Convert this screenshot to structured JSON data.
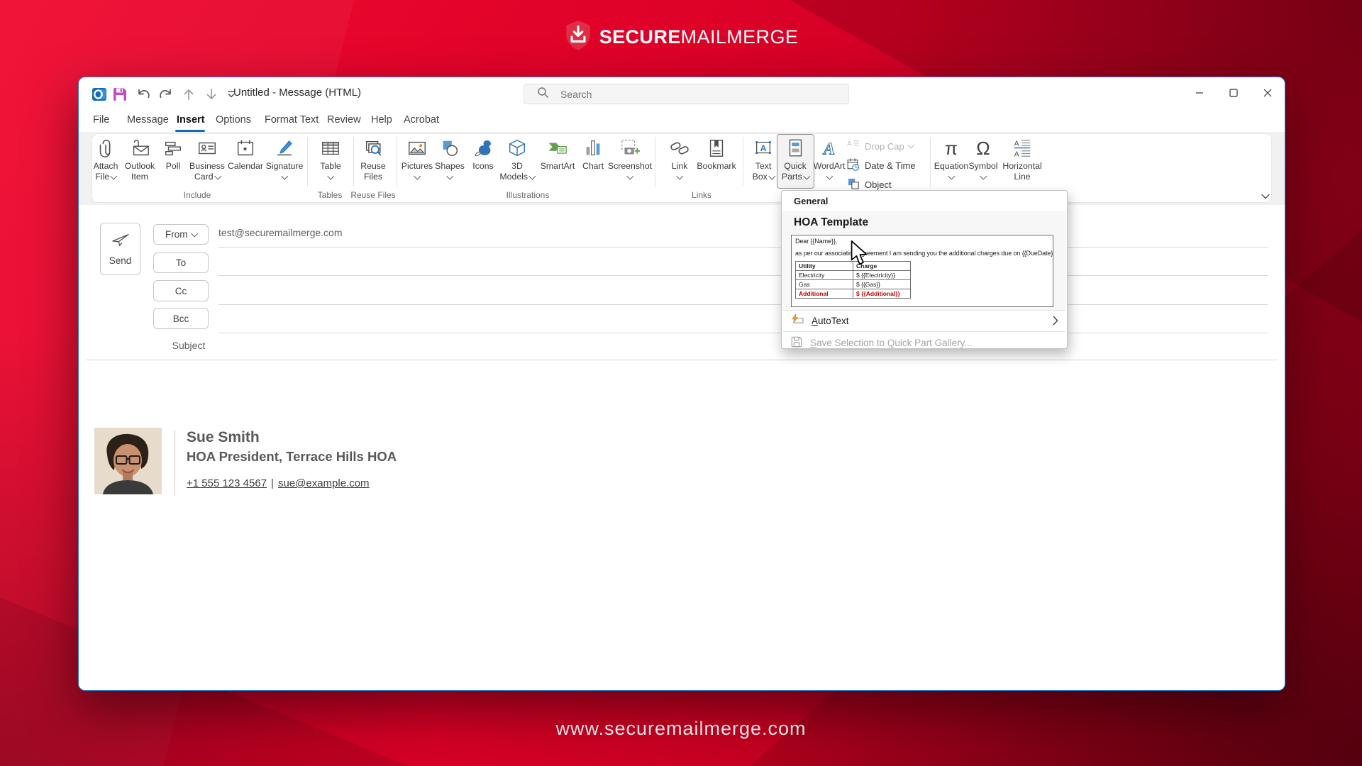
{
  "brand": {
    "bold": "SECURE",
    "rest": "MAILMERGE"
  },
  "footer_url": "www.securemailmerge.com",
  "window": {
    "title": "Untitled - Message (HTML)",
    "search_placeholder": "Search"
  },
  "tabs": [
    "File",
    "Message",
    "Insert",
    "Options",
    "Format Text",
    "Review",
    "Help",
    "Acrobat"
  ],
  "ribbon": {
    "attach_file_1": "Attach",
    "attach_file_2": "File",
    "outlook_item_1": "Outlook",
    "outlook_item_2": "Item",
    "poll": "Poll",
    "business_card_1": "Business",
    "business_card_2": "Card",
    "calendar": "Calendar",
    "signature": "Signature",
    "table": "Table",
    "reuse_files_1": "Reuse",
    "reuse_files_2": "Files",
    "pictures": "Pictures",
    "shapes": "Shapes",
    "icons": "Icons",
    "models_1": "3D",
    "models_2": "Models",
    "smartart": "SmartArt",
    "chart": "Chart",
    "screenshot": "Screenshot",
    "link": "Link",
    "bookmark": "Bookmark",
    "text_box_1": "Text",
    "text_box_2": "Box",
    "quick_parts_1": "Quick",
    "quick_parts_2": "Parts",
    "wordart": "WordArt",
    "drop_cap": "Drop Cap",
    "date_time": "Date & Time",
    "object": "Object",
    "equation": "Equation",
    "symbol": "Symbol",
    "horizontal_line_1": "Horizontal",
    "horizontal_line_2": "Line",
    "groups": {
      "include": "Include",
      "tables": "Tables",
      "reuse_files": "Reuse Files",
      "illustrations": "Illustrations",
      "links": "Links"
    }
  },
  "glyphs": {
    "equation": "π",
    "symbol": "Ω",
    "wordart": "A",
    "dropcap": "A",
    "textbox": "A",
    "outlook": "O"
  },
  "compose": {
    "send": "Send",
    "from": "From",
    "from_value": "test@securemailmerge.com",
    "to": "To",
    "cc": "Cc",
    "bcc": "Bcc",
    "subject": "Subject"
  },
  "signature": {
    "name": "Sue Smith",
    "role": "HOA President, Terrace Hills HOA",
    "phone": "+1 555 123 4567",
    "sep": "|",
    "email": "sue@example.com"
  },
  "menu": {
    "section": "General",
    "item": "HOA Template",
    "greeting": "Dear {{Name}},",
    "body": "as per our association agreement I am sending you the additional charges due on {{DueDate}}.",
    "col1": "Utility",
    "col2": "Charge",
    "r1c1": "Electricity",
    "r1c2": "$ {{Electricity}}",
    "r2c1": "Gas",
    "r2c2": "$ {{Gas}}",
    "r3c1": "Additional",
    "r3c2": "$ {{Additional}}",
    "autotext": "AutoText",
    "save_selection": "Save Selection to Quick Part Gallery..."
  }
}
